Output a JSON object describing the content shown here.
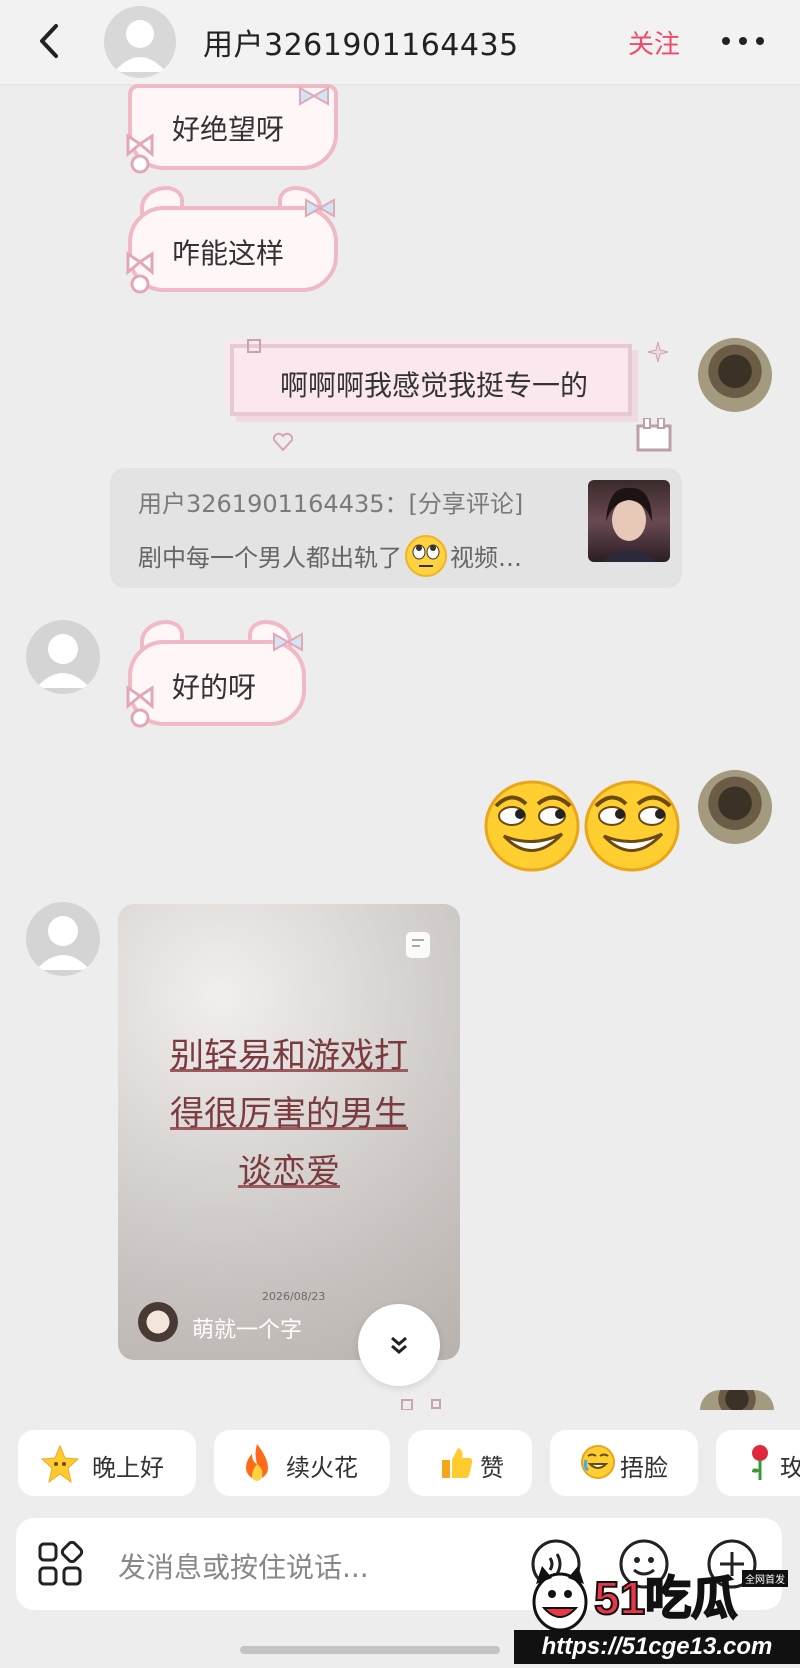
{
  "header": {
    "title": "用户3261901164435",
    "follow_label": "关注"
  },
  "messages": {
    "m1": "好绝望呀",
    "m2": "咋能这样",
    "m3": "啊啊啊我感觉我挺专一的",
    "share": {
      "line1": "用户3261901164435：[分享评论]",
      "line2_a": "剧中每一个男人都出轨了",
      "line2_b": "视频…"
    },
    "m4": "好的呀",
    "video": {
      "line1": "别轻易和游戏打",
      "line2": "得很厉害的男生",
      "line3": "谈恋爱",
      "date": "2026/08/23",
      "author": "萌就一个字"
    }
  },
  "quick_replies": [
    "晚上好",
    "续火花",
    "赞",
    "捂脸",
    "玫"
  ],
  "input": {
    "placeholder": "发消息或按住说话..."
  },
  "watermark": {
    "brand": "51吃瓜",
    "tag": "全网首发",
    "url": "https://51cge13.com"
  },
  "colors": {
    "accent": "#f04a6a",
    "bubble_border": "#efb9c6",
    "background": "#ededed"
  },
  "icons": [
    "back-icon",
    "more-icon",
    "scroll-down-icon",
    "apps-icon",
    "voice-icon",
    "emoji-icon",
    "plus-icon"
  ]
}
